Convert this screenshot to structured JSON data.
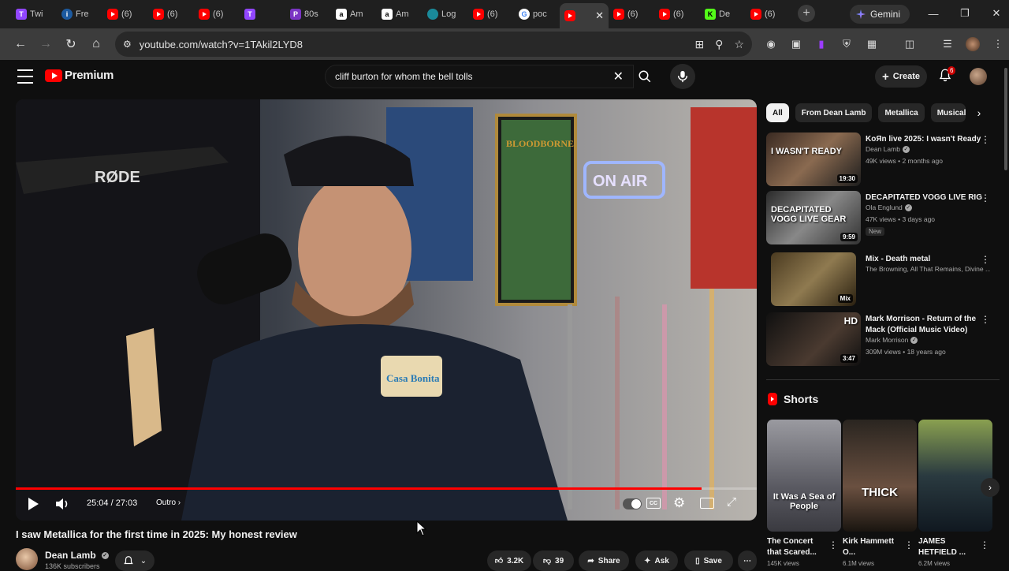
{
  "browser": {
    "tabs": [
      {
        "icon": "twitch-icon",
        "label": "Twi"
      },
      {
        "icon": "info-icon",
        "label": "Fre"
      },
      {
        "icon": "youtube-icon",
        "label": "(6)"
      },
      {
        "icon": "youtube-icon",
        "label": "(6)"
      },
      {
        "icon": "youtube-icon",
        "label": "(6)"
      },
      {
        "icon": "twitch-icon",
        "label": ""
      },
      {
        "icon": "purple-icon",
        "label": "80s"
      },
      {
        "icon": "amazon-icon",
        "label": "Am"
      },
      {
        "icon": "amazon-icon",
        "label": "Am"
      },
      {
        "icon": "globe-icon",
        "label": "Log"
      },
      {
        "icon": "youtube-icon",
        "label": "(6)"
      },
      {
        "icon": "google-icon",
        "label": "poc"
      },
      {
        "icon": "youtube-icon",
        "label": ""
      },
      {
        "icon": "youtube-icon",
        "label": "(6)"
      },
      {
        "icon": "youtube-icon",
        "label": "(6)"
      },
      {
        "icon": "kick-icon",
        "label": "De"
      },
      {
        "icon": "youtube-icon",
        "label": "(6)"
      }
    ],
    "active_tab_index": 12,
    "gemini_label": "Gemini",
    "url": "youtube.com/watch?v=1TAkil2LYD8"
  },
  "youtube": {
    "logo_text": "Premium",
    "search_value": "cliff burton for whom the bell tolls",
    "create_label": "Create",
    "notification_count": "6"
  },
  "player": {
    "time": "25:04 / 27:03",
    "chapter": "Outro",
    "progress": 0.926,
    "scene_text": {
      "mic_brand": "RØDE",
      "on_air": "ON AIR",
      "shirt": "Casa Bonita",
      "poster": "BLOODBORNE"
    }
  },
  "video": {
    "title": "I saw Metallica for the first time in 2025: My honest review",
    "channel": "Dean Lamb",
    "subscribers": "136K subscribers",
    "likes": "3.2K",
    "dislikes": "39",
    "share_label": "Share",
    "ask_label": "Ask",
    "save_label": "Save"
  },
  "chips": [
    "All",
    "From Dean Lamb",
    "Metallica",
    "Musical e"
  ],
  "recommendations": [
    {
      "title": "KoЯn live 2025: I wasn't Ready",
      "channel": "Dean Lamb",
      "verified": true,
      "meta": "49K views • 2 months ago",
      "duration": "19:30",
      "thumb_text": "I WASN'T READY"
    },
    {
      "title": "DECAPITATED VOGG LIVE RIG",
      "channel": "Ola Englund",
      "verified": true,
      "meta": "47K views • 3 days ago",
      "duration": "9:59",
      "badge": "New",
      "thumb_text": "DECAPITATED VOGG LIVE GEAR"
    },
    {
      "title": "Mix - Death metal",
      "channel": "The Browning, All That Remains, Divine ...",
      "verified": false,
      "meta": "",
      "duration": "Mix",
      "thumb_text": ""
    },
    {
      "title": "Mark Morrison - Return of the Mack (Official Music Video)",
      "channel": "Mark Morrison",
      "verified": true,
      "meta": "309M views • 18 years ago",
      "duration": "3:47",
      "thumb_text": "HD"
    }
  ],
  "shorts": {
    "heading": "Shorts",
    "items": [
      {
        "title": "The Concert that Scared...",
        "meta": "145K views",
        "caption": "It Was A Sea of People"
      },
      {
        "title": "Kirk Hammett O...",
        "meta": "6.1M views",
        "caption": "THICK"
      },
      {
        "title": "JAMES HETFIELD ...",
        "meta": "6.2M views",
        "caption": ""
      }
    ]
  },
  "colors": {
    "brand_red": "#ff0000",
    "background": "#0f0f0f",
    "surface": "#272727"
  }
}
